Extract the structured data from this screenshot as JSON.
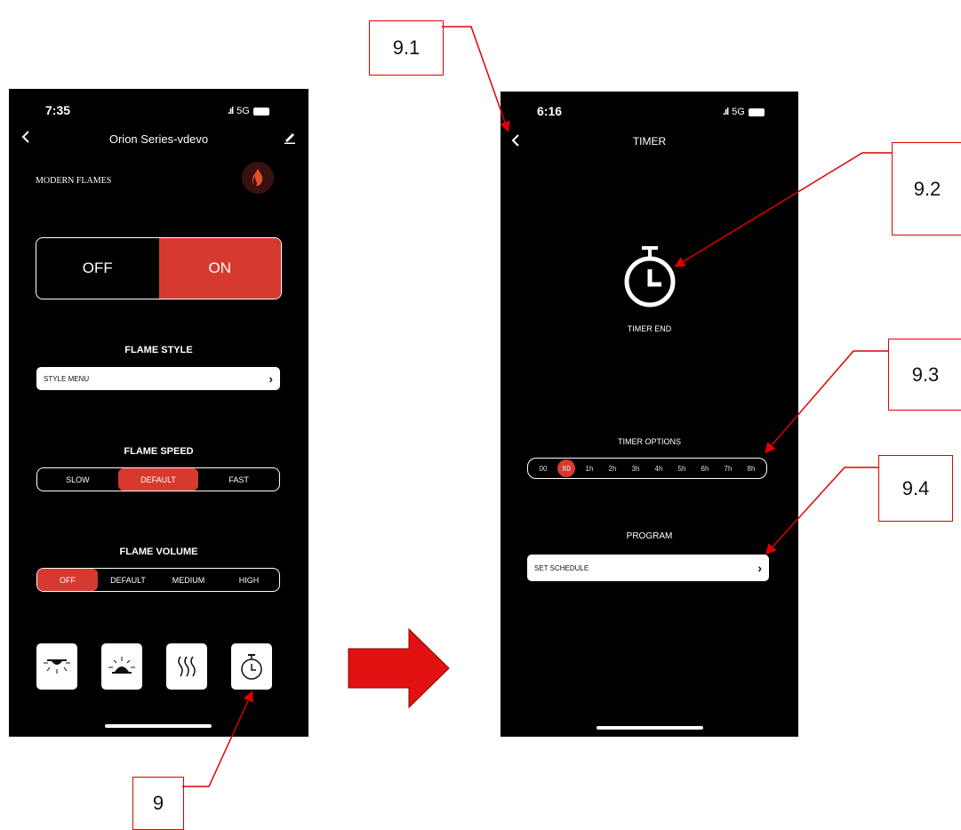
{
  "screen1": {
    "status_time": "7:35",
    "network": "5G",
    "header_title": "Orion Series-vdevo",
    "brand_logo_text": "MODERN FLAMES",
    "power_toggle": {
      "off_label": "OFF",
      "on_label": "ON",
      "selected": "ON"
    },
    "flame_style": {
      "title": "FLAME STYLE",
      "menu_label": "STYLE MENU"
    },
    "flame_speed": {
      "title": "FLAME SPEED",
      "options": [
        "SLOW",
        "DEFAULT",
        "FAST"
      ],
      "selected": "DEFAULT"
    },
    "flame_volume": {
      "title": "FLAME VOLUME",
      "options": [
        "OFF",
        "DEFAULT",
        "MEDIUM",
        "HIGH"
      ],
      "selected": "OFF"
    },
    "tiles": [
      {
        "icon": "ceiling-light-icon"
      },
      {
        "icon": "lamp-light-icon"
      },
      {
        "icon": "heat-icon"
      },
      {
        "icon": "timer-icon"
      }
    ]
  },
  "screen2": {
    "status_time": "6:16",
    "network": "5G",
    "header_title": "TIMER",
    "timer_status": "TIMER END",
    "timer_options": {
      "title": "TIMER OPTIONS",
      "options": [
        "00",
        "X0",
        "1h",
        "2h",
        "3h",
        "4h",
        "5h",
        "6h",
        "7h",
        "8h"
      ],
      "selected": "X0"
    },
    "program": {
      "title": "PROGRAM",
      "menu_label": "SET SCHEDULE"
    }
  },
  "callouts": {
    "c9": "9",
    "c91": "9.1",
    "c92": "9.2",
    "c93": "9.3",
    "c94": "9.4"
  },
  "colors": {
    "accent": "#d63a2f",
    "annotation": "#e00000",
    "screen_bg": "#000000"
  }
}
